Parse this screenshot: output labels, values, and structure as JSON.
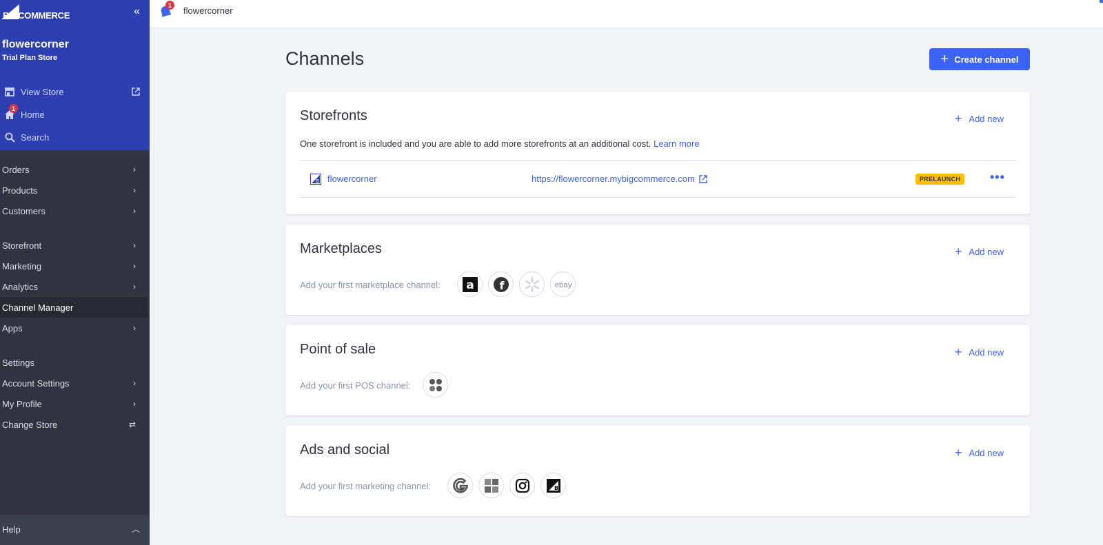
{
  "sidebar": {
    "logo_text": "BIGCOMMERCE",
    "store_name": "flowercorner",
    "store_plan": "Trial Plan Store",
    "top_links": {
      "view_store": "View Store",
      "home": "Home",
      "home_badge": "1",
      "search": "Search"
    },
    "nav": {
      "orders": "Orders",
      "products": "Products",
      "customers": "Customers",
      "storefront": "Storefront",
      "marketing": "Marketing",
      "analytics": "Analytics",
      "channel_manager": "Channel Manager",
      "apps": "Apps",
      "settings": "Settings",
      "account_settings": "Account Settings",
      "my_profile": "My Profile",
      "change_store": "Change Store"
    },
    "help": "Help"
  },
  "header": {
    "store": "flowercorner",
    "notification_count": "1"
  },
  "main": {
    "title": "Channels",
    "create_button": "Create channel",
    "storefronts": {
      "title": "Storefronts",
      "add_new": "Add new",
      "description": "One storefront is included and you are able to add more storefronts at an additional cost.",
      "learn_more": "Learn more",
      "row": {
        "name": "flowercorner",
        "url": "https://flowercorner.mybigcommerce.com",
        "status": "PRELAUNCH",
        "more": "•••"
      }
    },
    "marketplaces": {
      "title": "Marketplaces",
      "add_new": "Add new",
      "label": "Add your first marketplace channel:",
      "icons": [
        "amazon-icon",
        "facebook-icon",
        "walmart-icon",
        "ebay-icon"
      ]
    },
    "pos": {
      "title": "Point of sale",
      "add_new": "Add new",
      "label": "Add your first POS channel:",
      "icons": [
        "clover-icon"
      ]
    },
    "ads": {
      "title": "Ads and social",
      "add_new": "Add new",
      "label": "Add your first marketing channel:",
      "icons": [
        "google-icon",
        "microsoft-icon",
        "instagram-icon",
        "bigcommerce-icon"
      ]
    }
  },
  "colors": {
    "sidebar_top": "#2c3eb0",
    "sidebar": "#313440",
    "accent": "#3c64f4",
    "badge": "#ffbf00",
    "notification": "#db3643"
  }
}
